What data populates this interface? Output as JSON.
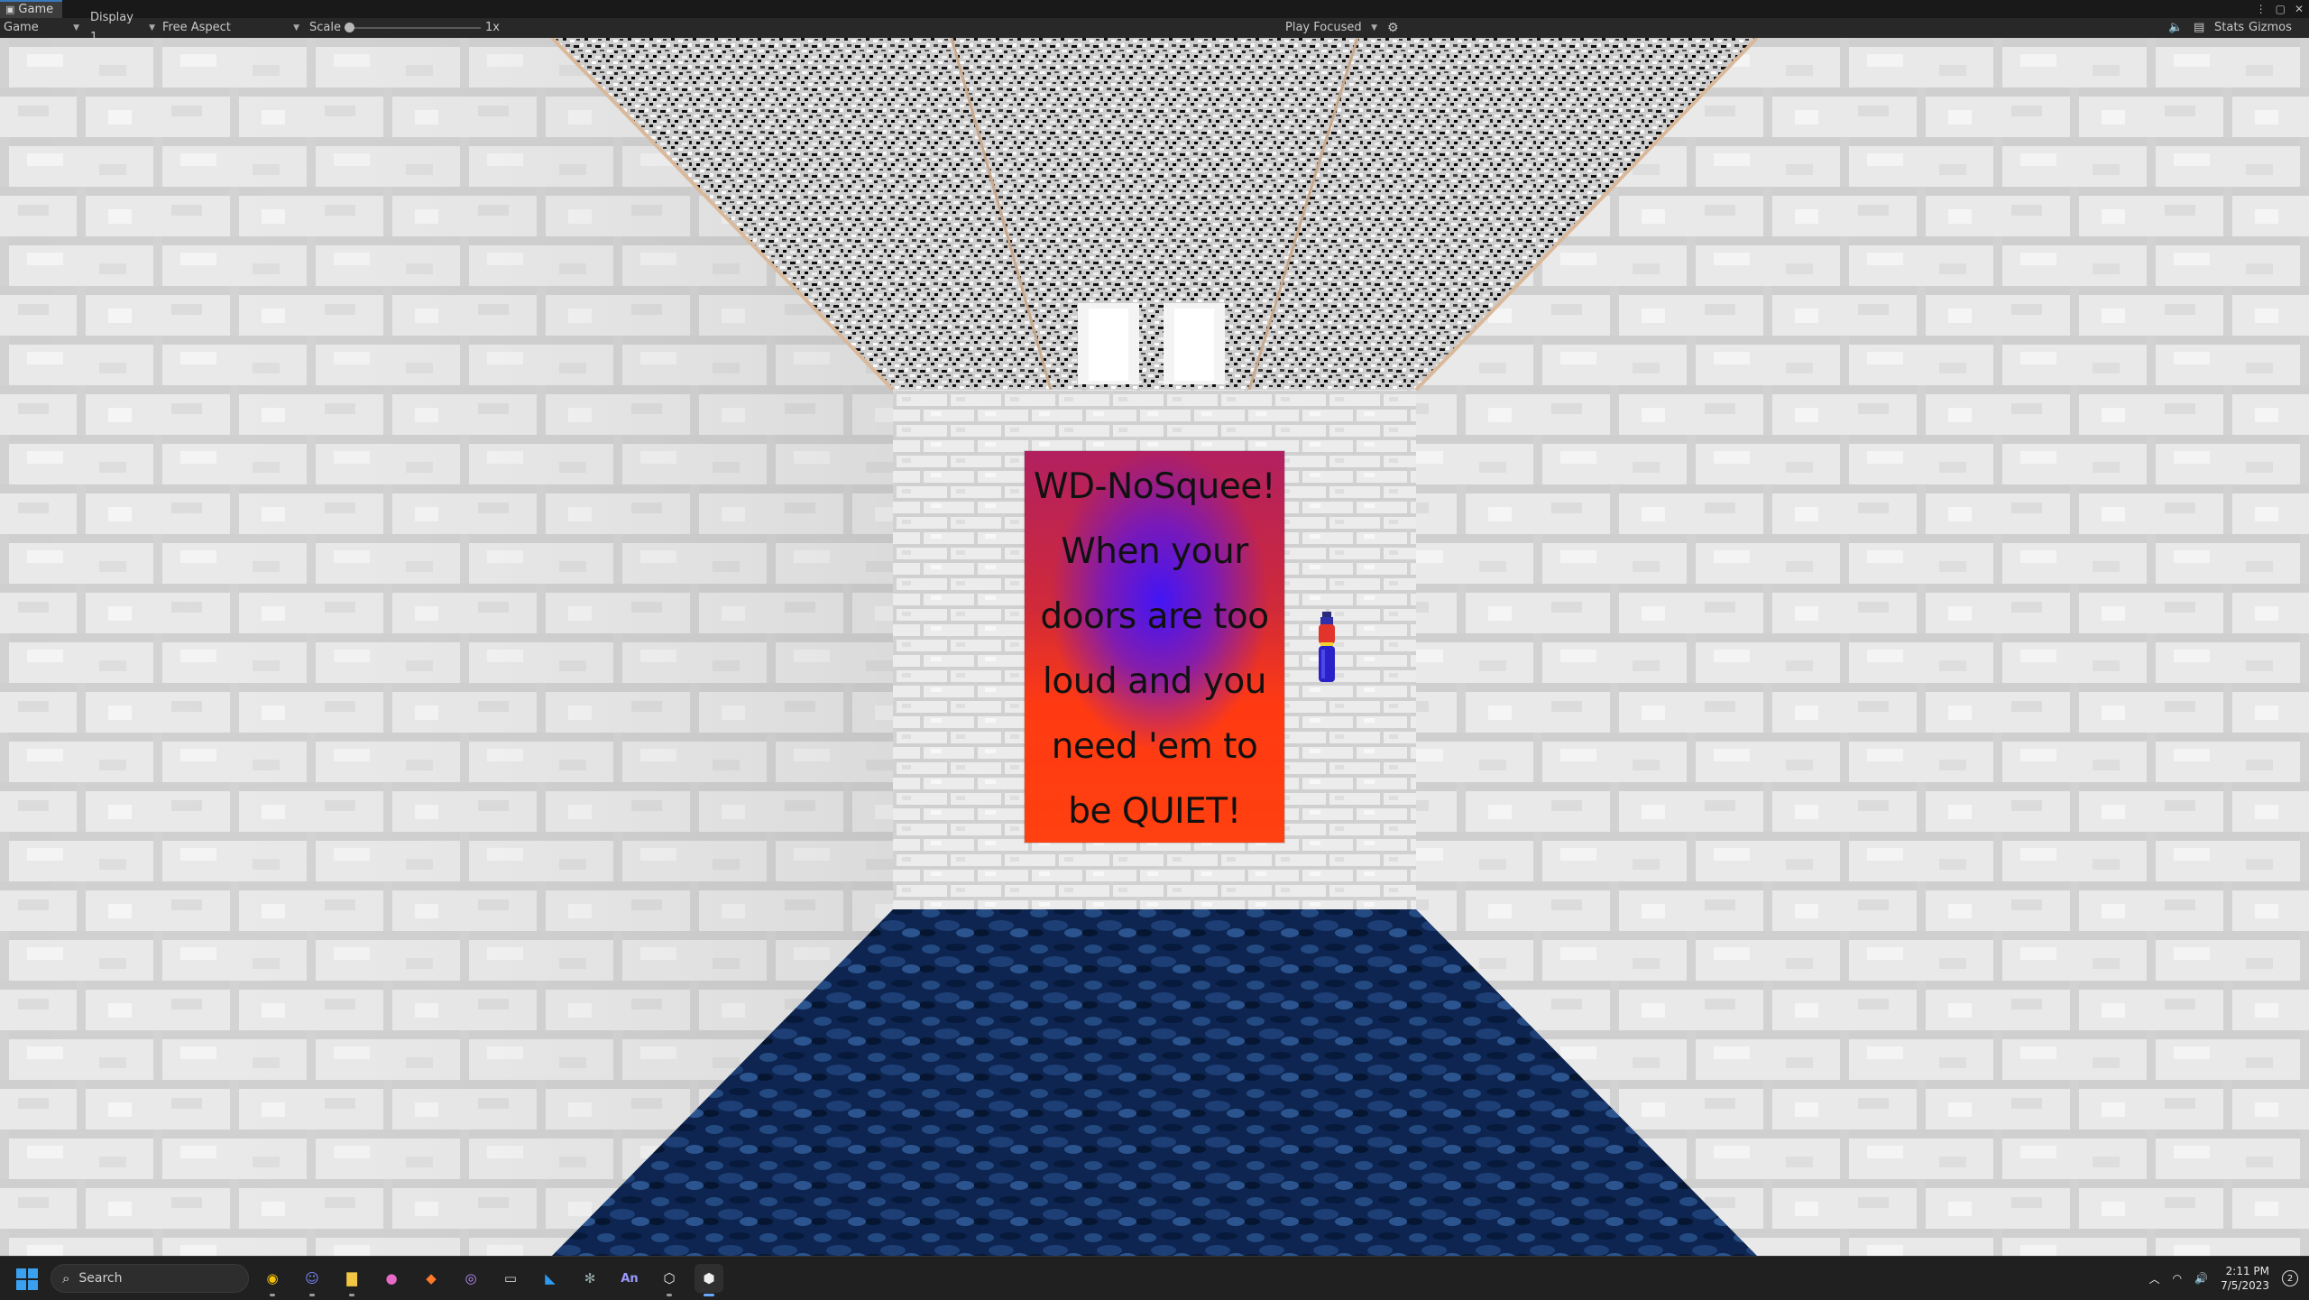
{
  "window": {
    "tab_label": "Game",
    "controls": [
      "⋮",
      "▢",
      "✕"
    ]
  },
  "toolbar": {
    "view_select": "Game",
    "display_select": "Display 1",
    "aspect_select": "Free Aspect",
    "scale_label": "Scale",
    "scale_value": 0,
    "scale_text": "1x",
    "play_mode": "Play Focused",
    "stats_label": "Stats",
    "gizmos_label": "Gizmos"
  },
  "scene": {
    "poster_lines": [
      "WD-NoSquee!",
      "When your",
      "doors are too",
      "loud and you",
      "need 'em to",
      "be QUIET!"
    ],
    "colors": {
      "wall": "#e6e6e6",
      "ceiling": "#c8c8c8",
      "floor": "#0e2a55",
      "poster_red": "#ff3a12",
      "poster_blue": "#3c14ff"
    },
    "items": [
      "bottle-item"
    ]
  },
  "taskbar": {
    "search_placeholder": "Search",
    "apps": [
      "chrome-icon",
      "discord-icon",
      "file-explorer-icon",
      "paint-icon",
      "brave-icon",
      "github-icon",
      "terminal-icon",
      "vscode-icon",
      "bug-icon",
      "animate-icon",
      "unity-hub-icon",
      "unity-icon"
    ],
    "apps_glyph": [
      "◉",
      "☺",
      "▇",
      "●",
      "◆",
      "◎",
      "▭",
      "◣",
      "✻",
      "An",
      "⬡",
      "⬢"
    ],
    "time": "2:11 PM",
    "date": "7/5/2023",
    "notification_count": "2"
  }
}
